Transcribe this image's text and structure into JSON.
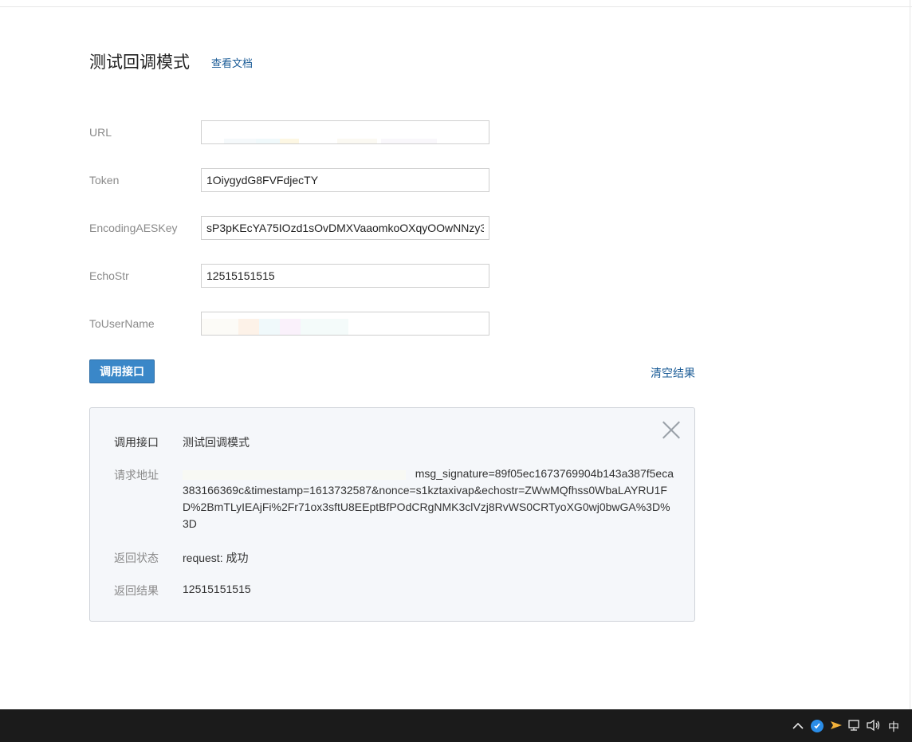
{
  "page": {
    "title": "测试回调模式",
    "doc_link": "查看文档"
  },
  "form": {
    "fields": [
      {
        "label": "URL",
        "value": ""
      },
      {
        "label": "Token",
        "value": "1OiygydG8FVFdjecTY"
      },
      {
        "label": "EncodingAESKey",
        "value": "sP3pKEcYA75IOzd1sOvDMXVaaomkoOXqyOOwNNzy3"
      },
      {
        "label": "EchoStr",
        "value": "12515151515"
      },
      {
        "label": "ToUserName",
        "value": ""
      }
    ],
    "call_button": "调用接口",
    "clear_link": "清空结果"
  },
  "result": {
    "api_label": "调用接口",
    "api_value": "测试回调模式",
    "request_label": "请求地址",
    "request_url_head": "msg_signature=89f05ec1673769904b143a387f5eca",
    "request_url_rest": "383166369c&timestamp=1613732587&nonce=s1kztaxivap&echostr=ZWwMQfhss0WbaLAYRU1FD%2BmTLyIEAjFi%2Fr71ox3sftU8EEptBfPOdCRgNMK3clVzj8RvWS0CRTyoXG0wj0bwGA%3D%3D",
    "status_label": "返回状态",
    "status_value": "request: 成功",
    "result_label": "返回结果",
    "result_value": "12515151515"
  },
  "taskbar": {
    "ime_label": "中",
    "icons": [
      "chevron-up-icon",
      "security-shield-icon",
      "paper-plane-icon",
      "network-icon",
      "volume-icon"
    ]
  }
}
